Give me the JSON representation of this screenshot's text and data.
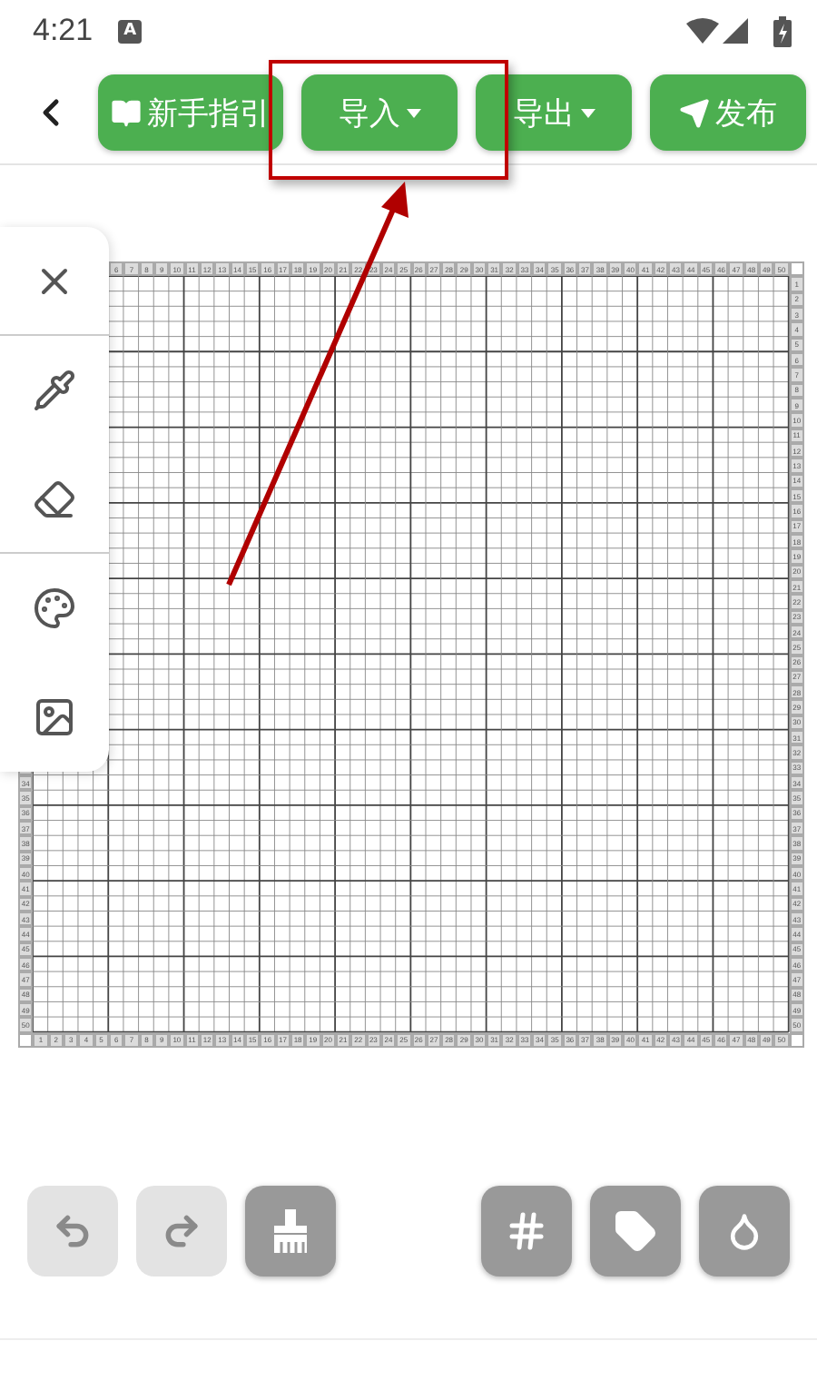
{
  "status_bar": {
    "time": "4:21",
    "notification": "A"
  },
  "top_bar": {
    "buttons": [
      {
        "label": "新手指引",
        "kind": "guide",
        "dropdown": false
      },
      {
        "label": "导入",
        "kind": "import",
        "dropdown": true
      },
      {
        "label": "导出",
        "kind": "export",
        "dropdown": true
      },
      {
        "label": "发布",
        "kind": "publish",
        "dropdown": false
      }
    ]
  },
  "side_tools": [
    {
      "kind": "close"
    },
    {
      "kind": "eyedropper"
    },
    {
      "kind": "eraser"
    },
    {
      "kind": "palette"
    },
    {
      "kind": "image"
    }
  ],
  "grid": {
    "top_labels": [
      "6",
      "7",
      "8",
      "9",
      "10",
      "11",
      "12",
      "13",
      "14",
      "15",
      "16",
      "17",
      "18",
      "19",
      "20",
      "21",
      "22",
      "23",
      "24",
      "25",
      "26",
      "27",
      "28",
      "29",
      "30",
      "31",
      "32",
      "33",
      "34",
      "35",
      "36",
      "37",
      "38",
      "39",
      "40",
      "41",
      "42",
      "43",
      "44",
      "45",
      "46",
      "47",
      "48",
      "49",
      "50"
    ],
    "left_labels": [
      "34",
      "35",
      "36",
      "37",
      "38",
      "39",
      "40",
      "41",
      "42",
      "43",
      "44",
      "45",
      "46",
      "47",
      "48",
      "49",
      "50"
    ],
    "right_labels": [
      "1",
      "2",
      "3",
      "4",
      "5",
      "6",
      "7",
      "8",
      "9",
      "10",
      "11",
      "12",
      "13",
      "14",
      "15",
      "16",
      "17",
      "18",
      "19",
      "20",
      "21",
      "22",
      "23",
      "24",
      "25",
      "26",
      "27",
      "28",
      "29",
      "30",
      "31",
      "32",
      "33",
      "34",
      "35",
      "36",
      "37",
      "38",
      "39",
      "40",
      "41",
      "42",
      "43",
      "44",
      "45",
      "46",
      "47",
      "48",
      "49",
      "50"
    ],
    "bottom_labels": [
      "1",
      "2",
      "3",
      "4",
      "5",
      "6",
      "7",
      "8",
      "9",
      "10",
      "11",
      "12",
      "13",
      "14",
      "15",
      "16",
      "17",
      "18",
      "19",
      "20",
      "21",
      "22",
      "23",
      "24",
      "25",
      "26",
      "27",
      "28",
      "29",
      "30",
      "31",
      "32",
      "33",
      "34",
      "35",
      "36",
      "37",
      "38",
      "39",
      "40",
      "41",
      "42",
      "43",
      "44",
      "45",
      "46",
      "47",
      "48",
      "49",
      "50"
    ]
  },
  "bottom_tools": [
    {
      "kind": "undo",
      "disabled": true
    },
    {
      "kind": "redo",
      "disabled": true
    },
    {
      "kind": "brush",
      "disabled": false
    },
    {
      "kind": "grid",
      "disabled": false
    },
    {
      "kind": "tag",
      "disabled": false
    },
    {
      "kind": "drop",
      "disabled": false
    }
  ]
}
